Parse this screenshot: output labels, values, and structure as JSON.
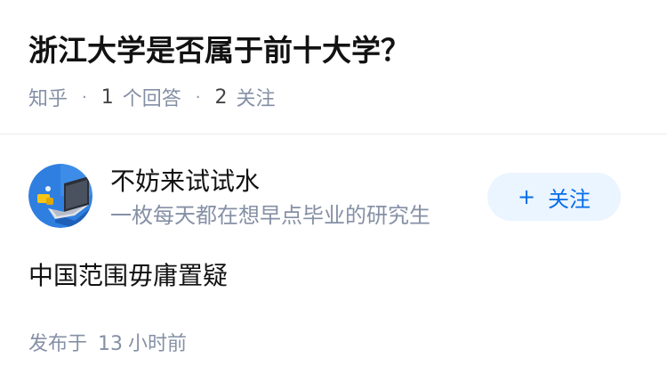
{
  "question": {
    "title": "浙江大学是否属于前十大学？",
    "meta": {
      "source": "知乎",
      "answer_count": "1",
      "answer_label": "个回答",
      "follow_count": "2",
      "follow_label": "关注"
    }
  },
  "answer": {
    "author": {
      "name": "不妨来试试水",
      "bio": "一枚每天都在想早点毕业的研究生",
      "avatar_icon": "laptop-avatar-icon"
    },
    "follow_button": {
      "icon": "+",
      "label": "关注"
    },
    "content": "中国范围毋庸置疑",
    "time": {
      "prefix": "发布于",
      "value": "13",
      "unit": "小时前"
    }
  },
  "colors": {
    "accent": "#056de8",
    "accent_bg": "#ebf5ff",
    "meta_gray": "#8590a6",
    "text": "#121212",
    "avatar_bg": "#2f7fe0"
  }
}
